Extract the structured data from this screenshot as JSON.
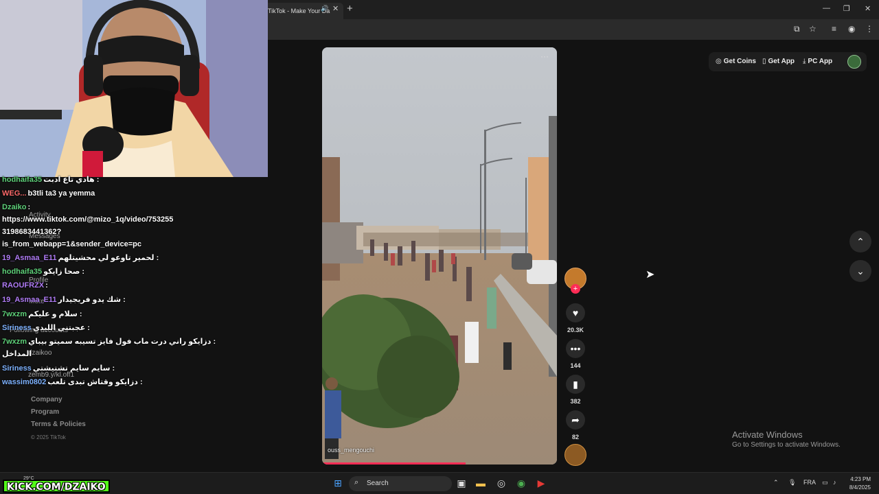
{
  "browser": {
    "tab_title": "TikTok - Make Your Da",
    "tab_audio_icon": "speaker-icon",
    "tab_close": "✕",
    "new_tab": "+",
    "window_minimize": "—",
    "window_restore": "❐",
    "window_close": "✕"
  },
  "topbar": {
    "get_coins": "Get Coins",
    "get_app": "Get App",
    "pc_app": "PC App"
  },
  "sidebar_links": [
    "Company",
    "Program",
    "Terms & Policies"
  ],
  "copyright": "© 2025 TikTok",
  "video": {
    "author": "ouss_mengouchi",
    "progress": 0.61
  },
  "actions": {
    "likes": "20.3K",
    "comments": "144",
    "saves": "382",
    "shares": "82"
  },
  "chat": [
    {
      "user": "hodhaifa35",
      "user_color": "#5fd27a",
      "message": "هادي تاع ادبت :"
    },
    {
      "user": "WEG...",
      "user_color": "#ff6b6b",
      "message": "b3tli ta3 ya yemma"
    },
    {
      "user": "Dzaiko",
      "user_color": "#5fd27a",
      "message": ":"
    },
    {
      "user": "",
      "user_color": "#ffffff",
      "message": "https://www.tiktok.com/@mizo_1q/video/753255"
    },
    {
      "user": "",
      "user_color": "#ffffff",
      "message": "3198683441362?"
    },
    {
      "user": "",
      "user_color": "#ffffff",
      "message": "is_from_webapp=1&sender_device=pc"
    },
    {
      "user": "19_Asmaa_E11",
      "user_color": "#b07cf5",
      "message": "لحمير تاوعو لي محشيتلهم :"
    },
    {
      "user": "hodhaifa35",
      "user_color": "#5fd27a",
      "message": "صحا زايكو :"
    },
    {
      "user": "RAOUFRZX",
      "user_color": "#b07cf5",
      "message": ":"
    },
    {
      "user": "19_Asmaa_E11",
      "user_color": "#b07cf5",
      "message": "شك يدو فريجيدار :"
    },
    {
      "user": "7wxzm",
      "user_color": "#5fd27a",
      "message": "سلام و عليكم :"
    },
    {
      "user": "Siriness",
      "user_color": "#7fb3ff",
      "message": "عجبتني الليدي :"
    },
    {
      "user": "7wxzm",
      "user_color": "#5fd27a",
      "message": "دزايكو راني درت ماب فول فايز تسيبه سميتو بيباي :"
    },
    {
      "user": "",
      "user_color": "#ffffff",
      "message": "المداخل"
    },
    {
      "user": "Siriness",
      "user_color": "#7fb3ff",
      "message": "سايم سايم تشتيشتي :"
    },
    {
      "user": "wassim0802",
      "user_color": "#7fb3ff",
      "message": "دزايكو وقتاش تبدى تلعب :"
    }
  ],
  "ghost_sidebar": {
    "activity": "Activity",
    "messages": "Messages",
    "profile": "Profile",
    "more": "More",
    "following_accounts": "Following accounts",
    "account_name": "dzaikoo",
    "account_handle": "zemb9.y/kl.off1"
  },
  "windows": {
    "activate_title": "Activate Windows",
    "activate_sub": "Go to Settings to activate Windows."
  },
  "taskbar": {
    "search": "Search",
    "lang": "FRA",
    "time": "4:23 PM",
    "date": "8/4/2025",
    "weather": "29°C"
  },
  "overlay": {
    "kick_text": "KICK.COM/DZAIKO"
  },
  "colors": {
    "accent_red": "#fe2c55",
    "kick_green": "#53fc18"
  }
}
